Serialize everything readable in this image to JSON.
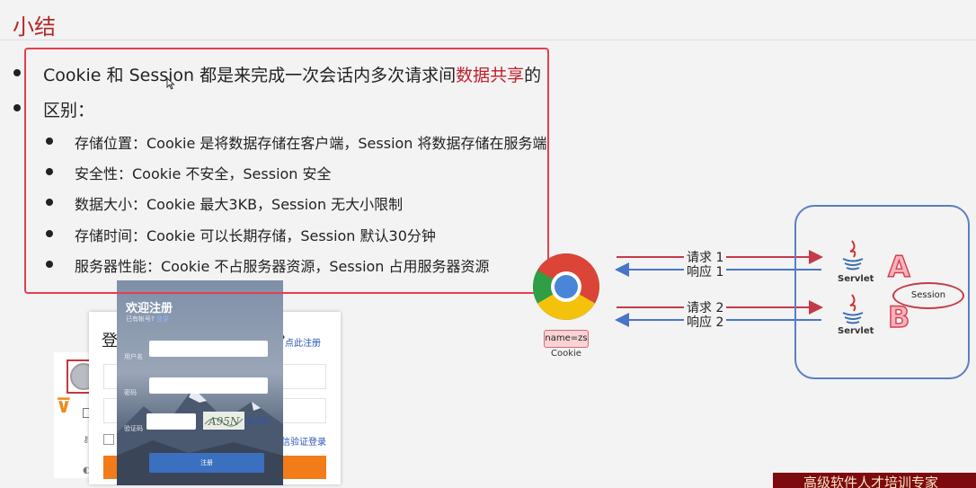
{
  "slide": {
    "title": "小结"
  },
  "bullets": {
    "b1": {
      "pre": "Cookie 和 Sess",
      "pre2": "on 都是来完成一次会话内多次请求间",
      "highlight": "数据共享",
      "post": "的"
    },
    "b2": "区别："
  },
  "differences": [
    {
      "label": "存储位置：Cookie 是将数据存储在客户端，Session 将数据存储在服务端"
    },
    {
      "label": "安全性：Cookie 不安全，Session 安全"
    },
    {
      "label": "数据大小：Cookie 最大3KB，Session 无大小限制"
    },
    {
      "label": "存储时间：Cookie 可以长期存储，Session 默认30分钟"
    },
    {
      "label": "服务器性能：Cookie 不占服务器资源，Session 占用服务器资源"
    }
  ],
  "login_form": {
    "title": "登",
    "question": "?",
    "register_link": "点此注册",
    "sms_link": "信验证登录"
  },
  "register_form": {
    "title": "欢迎注册",
    "subtitle": "已有帐号?",
    "login_link": "登录",
    "username_label": "用户名",
    "password_label": "密码",
    "captcha_label": "验证码",
    "captcha_text": "A95N",
    "captcha_refresh": "看不清?",
    "submit": "注册"
  },
  "diagram": {
    "cookie_value": "name=zs",
    "cookie_label": "Cookie",
    "request1": "请求 1",
    "response1": "响应 1",
    "request2": "请求 2",
    "response2": "响应 2",
    "servlet_a": "Servlet",
    "servlet_b": "Servlet",
    "letter_a": "A",
    "letter_b": "B",
    "session": "Session"
  },
  "watermark": "高级软件人才培训专家",
  "colors": {
    "accent_red": "#c01f2c",
    "box_blue": "#5a7fc1",
    "arrow_red": "#c43a48",
    "arrow_blue": "#4a74c8"
  }
}
